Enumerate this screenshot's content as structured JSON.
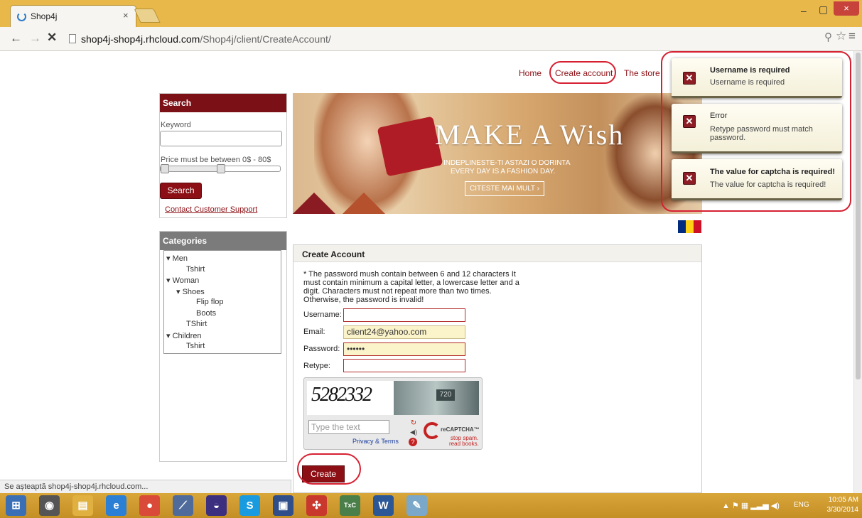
{
  "browser": {
    "tab_title": "Shop4j",
    "tab_close": "×",
    "url_host": "shop4j-shop4j.rhcloud.com",
    "url_path": "/Shop4j/client/CreateAccount/",
    "status_text": "Se așteaptă shop4j-shop4j.rhcloud.com...",
    "window_min": "–",
    "window_max": "▢",
    "window_close": "×"
  },
  "nav": {
    "home": "Home",
    "create_account": "Create account",
    "store": "The store"
  },
  "sidebar": {
    "search": {
      "title": "Search",
      "keyword_label": "Keyword",
      "keyword_value": "",
      "price_label": "Price must be between 0$ - 80$",
      "price_range": [
        0,
        80
      ],
      "price_selected": [
        0,
        40
      ],
      "button": "Search",
      "contact_link": "Contact Customer Support"
    },
    "categories": {
      "title": "Categories",
      "items": [
        {
          "label": "▾ Men",
          "level": 0
        },
        {
          "label": "Tshirt",
          "level": 1
        },
        {
          "label": "▾ Woman",
          "level": 0
        },
        {
          "label": "▾ Shoes",
          "level": 1
        },
        {
          "label": "Flip flop",
          "level": 2
        },
        {
          "label": "Boots",
          "level": 2
        },
        {
          "label": "TShirt",
          "level": 1
        },
        {
          "label": "▾ Children",
          "level": 0
        },
        {
          "label": "Tshirt",
          "level": 1
        }
      ]
    }
  },
  "banner": {
    "title": "MAKE A Wish",
    "line1": "INDEPLINESTE-TI ASTAZI O DORINTA",
    "line2": "EVERY DAY IS A FASHION DAY.",
    "cta": "CITESTE MAI MULT ›"
  },
  "flag_colors": [
    "#002b7f",
    "#fcd116",
    "#ce1126"
  ],
  "form": {
    "title": "Create Account",
    "rules": "* The password mush contain between 6 and 12 characters It must contain minimum a capital letter, a lowercase letter and a digit. Characters must not repeat more than two times. Otherwise, the password is invalid!",
    "username_label": "Username:",
    "username_value": "",
    "email_label": "Email:",
    "email_value": "client24@yahoo.com",
    "password_label": "Password:",
    "password_value": "••••••",
    "retype_label": "Retype:",
    "retype_value": "",
    "captcha": {
      "challenge": "5282332",
      "photo_number": "720",
      "placeholder": "Type the text",
      "privacy": "Privacy & Terms",
      "brand": "reCAPTCHA™",
      "tagline1": "stop spam.",
      "tagline2": "read books."
    },
    "create_button": "Create"
  },
  "notifications": [
    {
      "title": "Username is required",
      "body": "Username is required"
    },
    {
      "title": "Error",
      "body": "Retype password must match password."
    },
    {
      "title": "The value for captcha is required!",
      "body": "The value for captcha is required!"
    }
  ],
  "taskbar": {
    "lang": "ENG",
    "time": "10:05 AM",
    "date": "3/30/2014",
    "apps": [
      {
        "name": "start",
        "glyph": "⊞",
        "color": "#3a6fb5"
      },
      {
        "name": "chrome-unused",
        "glyph": "◉",
        "color": "#555555"
      },
      {
        "name": "file-explorer",
        "glyph": "▤",
        "color": "#e0b040"
      },
      {
        "name": "internet-explorer",
        "glyph": "e",
        "color": "#2b7fd4"
      },
      {
        "name": "chrome",
        "glyph": "●",
        "color": "#d94a38"
      },
      {
        "name": "app-tool",
        "glyph": "⟋",
        "color": "#4f6b9c"
      },
      {
        "name": "eclipse",
        "glyph": "◒",
        "color": "#3d2f80"
      },
      {
        "name": "skype",
        "glyph": "S",
        "color": "#1a9be0"
      },
      {
        "name": "save",
        "glyph": "▣",
        "color": "#2f4e8a"
      },
      {
        "name": "app-red",
        "glyph": "✣",
        "color": "#c9382d"
      },
      {
        "name": "texmaker",
        "glyph": "TxC",
        "color": "#4a7f4a"
      },
      {
        "name": "word",
        "glyph": "W",
        "color": "#2b5797"
      },
      {
        "name": "paint",
        "glyph": "✎",
        "color": "#7ba7c9"
      }
    ]
  }
}
